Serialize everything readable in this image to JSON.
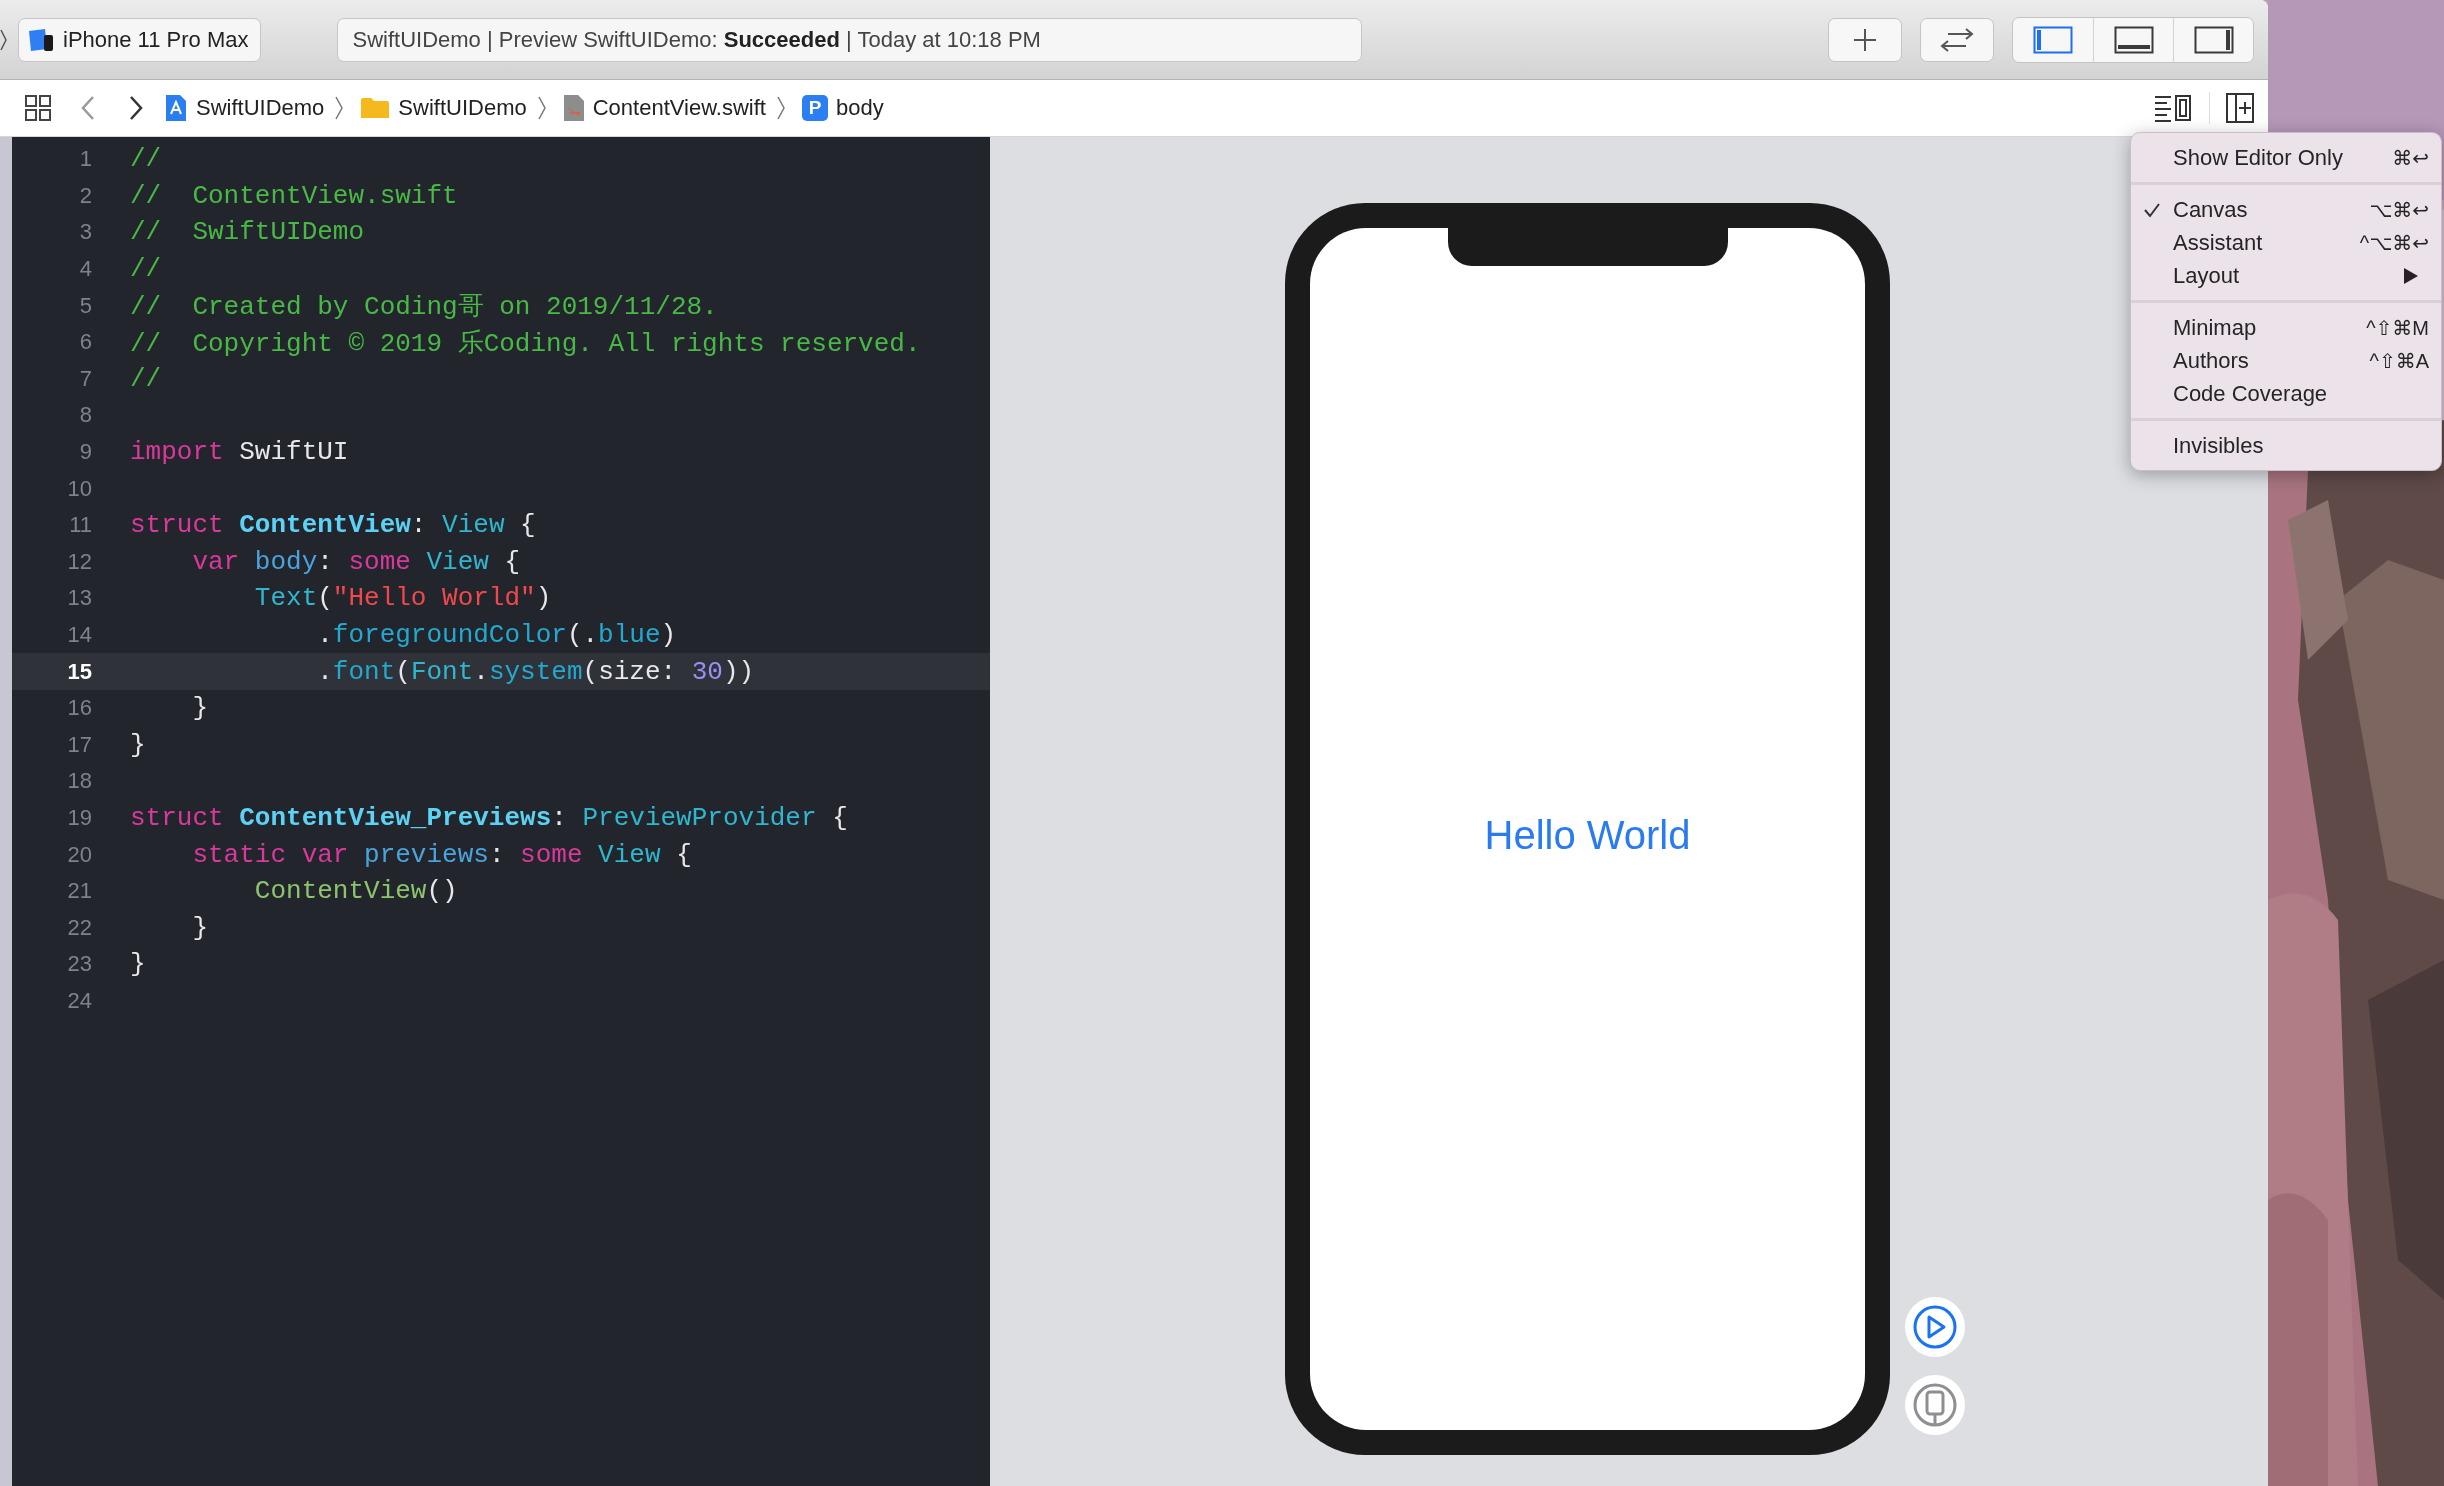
{
  "toolbar": {
    "scheme": {
      "name": "iPhone 11 Pro Max"
    },
    "activity": {
      "text": "SwiftUIDemo | Preview SwiftUIDemo: **Succeeded** | Today at 10:18 PM"
    },
    "panel_toggles": [
      {
        "kind": "left",
        "selected": true
      },
      {
        "kind": "bottom",
        "selected": false
      },
      {
        "kind": "right",
        "selected": false
      }
    ]
  },
  "jump_bar": {
    "nav": [
      {
        "kind": "back",
        "disabled": true
      },
      {
        "kind": "forward",
        "disabled": false
      }
    ],
    "crumbs": [
      {
        "kind": "project",
        "label": "SwiftUIDemo"
      },
      {
        "kind": "folder",
        "label": "SwiftUIDemo"
      },
      {
        "kind": "swift",
        "label": "ContentView.swift"
      },
      {
        "kind": "symbol",
        "badge": "P",
        "label": "body"
      }
    ]
  },
  "editor": {
    "lines": [
      {
        "number": "1",
        "current": false,
        "tokens": [
          {
            "text": "//",
            "kind": "comment"
          }
        ]
      },
      {
        "number": "2",
        "current": false,
        "tokens": [
          {
            "text": "//  ContentView.swift",
            "kind": "comment"
          }
        ]
      },
      {
        "number": "3",
        "current": false,
        "tokens": [
          {
            "text": "//  SwiftUIDemo",
            "kind": "comment"
          }
        ]
      },
      {
        "number": "4",
        "current": false,
        "tokens": [
          {
            "text": "//",
            "kind": "comment"
          }
        ]
      },
      {
        "number": "5",
        "current": false,
        "tokens": [
          {
            "text": "//  Created by Coding哥 on 2019/11/28.",
            "kind": "comment"
          }
        ]
      },
      {
        "number": "6",
        "current": false,
        "tokens": [
          {
            "text": "//  Copyright © 2019 乐Coding. All rights reserved.",
            "kind": "comment"
          }
        ]
      },
      {
        "number": "7",
        "current": false,
        "tokens": [
          {
            "text": "//",
            "kind": "comment"
          }
        ]
      },
      {
        "number": "8",
        "current": false
      },
      {
        "number": "9",
        "current": false,
        "tokens": [
          {
            "text": "import",
            "kind": "keyword"
          },
          {
            "text": " SwiftUI",
            "kind": "plain"
          }
        ]
      },
      {
        "number": "10",
        "current": false
      },
      {
        "number": "11",
        "current": false,
        "tokens": [
          {
            "text": "struct ",
            "kind": "keyword"
          },
          {
            "text": "ContentView",
            "kind": "decl"
          },
          {
            "text": ": ",
            "kind": "plain"
          },
          {
            "text": "View",
            "kind": "type"
          },
          {
            "text": " {",
            "kind": "plain"
          }
        ]
      },
      {
        "number": "12",
        "current": false,
        "tokens": [
          {
            "text": "    var ",
            "kind": "keyword"
          },
          {
            "text": "body",
            "kind": "prop"
          },
          {
            "text": ": ",
            "kind": "plain"
          },
          {
            "text": "some ",
            "kind": "keyword"
          },
          {
            "text": "View",
            "kind": "type"
          },
          {
            "text": " {",
            "kind": "plain"
          }
        ]
      },
      {
        "number": "13",
        "current": false,
        "tokens": [
          {
            "text": "        Text",
            "kind": "type"
          },
          {
            "text": "(",
            "kind": "plain"
          },
          {
            "text": "\"Hello World\"",
            "kind": "string"
          },
          {
            "text": ")",
            "kind": "plain"
          }
        ]
      },
      {
        "number": "14",
        "current": false,
        "tokens": [
          {
            "text": "            .",
            "kind": "plain"
          },
          {
            "text": "foregroundColor",
            "kind": "func"
          },
          {
            "text": "(.",
            "kind": "plain"
          },
          {
            "text": "blue",
            "kind": "func"
          },
          {
            "text": ")",
            "kind": "plain"
          }
        ]
      },
      {
        "number": "15",
        "current": true,
        "tokens": [
          {
            "text": "            .",
            "kind": "plain"
          },
          {
            "text": "font",
            "kind": "func"
          },
          {
            "text": "(",
            "kind": "plain"
          },
          {
            "text": "Font",
            "kind": "type"
          },
          {
            "text": ".",
            "kind": "plain"
          },
          {
            "text": "system",
            "kind": "func"
          },
          {
            "text": "(size: ",
            "kind": "plain"
          },
          {
            "text": "30",
            "kind": "number"
          },
          {
            "text": "))",
            "kind": "plain"
          }
        ]
      },
      {
        "number": "16",
        "current": false,
        "tokens": [
          {
            "text": "    }",
            "kind": "plain"
          }
        ]
      },
      {
        "number": "17",
        "current": false,
        "tokens": [
          {
            "text": "}",
            "kind": "plain"
          }
        ]
      },
      {
        "number": "18",
        "current": false
      },
      {
        "number": "19",
        "current": false,
        "tokens": [
          {
            "text": "struct ",
            "kind": "keyword"
          },
          {
            "text": "ContentView_Previews",
            "kind": "decl"
          },
          {
            "text": ": ",
            "kind": "plain"
          },
          {
            "text": "PreviewProvider",
            "kind": "type"
          },
          {
            "text": " {",
            "kind": "plain"
          }
        ]
      },
      {
        "number": "20",
        "current": false,
        "tokens": [
          {
            "text": "    static var ",
            "kind": "keyword"
          },
          {
            "text": "previews",
            "kind": "prop"
          },
          {
            "text": ": ",
            "kind": "plain"
          },
          {
            "text": "some ",
            "kind": "keyword"
          },
          {
            "text": "View",
            "kind": "type"
          },
          {
            "text": " {",
            "kind": "plain"
          }
        ]
      },
      {
        "number": "21",
        "current": false,
        "tokens": [
          {
            "text": "        ContentView",
            "kind": "project"
          },
          {
            "text": "()",
            "kind": "plain"
          }
        ]
      },
      {
        "number": "22",
        "current": false,
        "tokens": [
          {
            "text": "    }",
            "kind": "plain"
          }
        ]
      },
      {
        "number": "23",
        "current": false,
        "tokens": [
          {
            "text": "}",
            "kind": "plain"
          }
        ]
      },
      {
        "number": "24",
        "current": false
      }
    ]
  },
  "preview": {
    "text": "Hello World"
  },
  "menu": [
    {
      "kind": "item",
      "label": "Show Editor Only",
      "shortcut": "⌘↩",
      "checked": false,
      "submenu": false
    },
    {
      "kind": "separator"
    },
    {
      "kind": "item",
      "label": "Canvas",
      "shortcut": "⌥⌘↩",
      "checked": true,
      "submenu": false
    },
    {
      "kind": "item",
      "label": "Assistant",
      "shortcut": "^⌥⌘↩",
      "checked": false,
      "submenu": false
    },
    {
      "kind": "item",
      "label": "Layout",
      "checked": false,
      "submenu": true
    },
    {
      "kind": "separator"
    },
    {
      "kind": "item",
      "label": "Minimap",
      "shortcut": "^⇧⌘M",
      "checked": false,
      "submenu": false
    },
    {
      "kind": "item",
      "label": "Authors",
      "shortcut": "^⇧⌘A",
      "checked": false,
      "submenu": false
    },
    {
      "kind": "item",
      "label": "Code Coverage",
      "checked": false,
      "submenu": false
    },
    {
      "kind": "separator"
    },
    {
      "kind": "item",
      "label": "Invisibles",
      "checked": false,
      "submenu": false
    }
  ]
}
